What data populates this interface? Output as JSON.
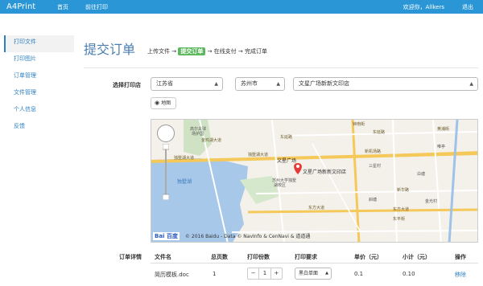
{
  "navbar": {
    "brand": "A4Print",
    "links": [
      "首页",
      "前往打印"
    ],
    "welcome": "欢迎你，Allkers",
    "logout": "退出",
    "color": "#2a96d6"
  },
  "sidebar": {
    "items": [
      {
        "label": "打印文件",
        "active": true
      },
      {
        "label": "打印图片"
      },
      {
        "label": "订单管理"
      },
      {
        "label": "文件管理"
      },
      {
        "label": "个人信息"
      },
      {
        "label": "反馈"
      }
    ]
  },
  "page": {
    "title": "提交订单",
    "steps": {
      "s1": "上传文件 →",
      "s2": "提交订单",
      "s3": "→ 在线支付 → 完成订单"
    }
  },
  "shop": {
    "label": "选择打印店",
    "province": "江苏省",
    "city": "苏州市",
    "shop": "文星广场新新文印店",
    "map_button": "地图"
  },
  "map": {
    "logo": "Bai 百度",
    "copyright": "© 2016 Baidu - Data © NavInfo & CenNavi & 道道通",
    "labels": {
      "l1": "高尔夫球",
      "l2": "场护国",
      "l3": "金鸡湖大道",
      "l4": "东延路",
      "l5": "东延路",
      "l6": "独墅湖大道",
      "l7": "独墅湖大道",
      "l8": "新机场路",
      "l9": "文星广场",
      "l10": "文星广场新新文印店",
      "l11": "苏州大学独墅",
      "l12": "湖校区",
      "l13": "独墅湖",
      "l14": "东方大道",
      "l15": "东方大道",
      "l16": "钟南街",
      "l17": "黄浦街",
      "l18": "新华路",
      "l19": "三星村",
      "l20": "东平街",
      "l21": "唯亭",
      "l22": "斜塘",
      "l23": "白塘",
      "l24": "金光村"
    }
  },
  "order": {
    "label": "订单详情",
    "headers": [
      "文件名",
      "总页数",
      "打印份数",
      "打印要求",
      "单价（元）",
      "小计（元）",
      "操作"
    ],
    "row": {
      "filename": "简历模板.doc",
      "pages": "1",
      "minus": "−",
      "copies": "1",
      "plus": "+",
      "requirement": "黑白单面",
      "unit_price": "0.1",
      "subtotal": "0.10",
      "action": "移除"
    }
  }
}
